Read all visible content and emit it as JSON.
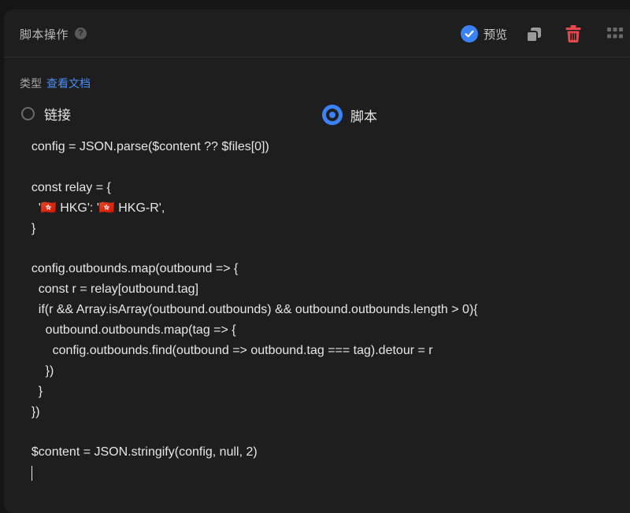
{
  "header": {
    "title": "脚本操作",
    "help_glyph": "?",
    "preview_label": "预览"
  },
  "type_row": {
    "label": "类型",
    "docs_link": "查看文档"
  },
  "radios": {
    "link_label": "链接",
    "script_label": "脚本",
    "selected": "脚本"
  },
  "colors": {
    "accent": "#3b82f6",
    "danger": "#e5484d",
    "background": "#1e1e1e"
  },
  "icons": {
    "help": "question-circle-icon",
    "preview": "check-circle-icon",
    "copy": "copy-icon",
    "delete": "trash-icon",
    "drag": "grip-dots-icon"
  },
  "editor": {
    "lines": [
      "  config = JSON.parse($content ?? $files[0])",
      "",
      "  const relay = {",
      "    '🇭🇰 HKG': '🇭🇰 HKG-R',",
      "  }",
      "",
      "  config.outbounds.map(outbound => {",
      "    const r = relay[outbound.tag]",
      "    if(r && Array.isArray(outbound.outbounds) && outbound.outbounds.length > 0){",
      "      outbound.outbounds.map(tag => {",
      "        config.outbounds.find(outbound => outbound.tag === tag).detour = r",
      "      })",
      "    }",
      "  })",
      "",
      "  $content = JSON.stringify(config, null, 2)"
    ]
  }
}
